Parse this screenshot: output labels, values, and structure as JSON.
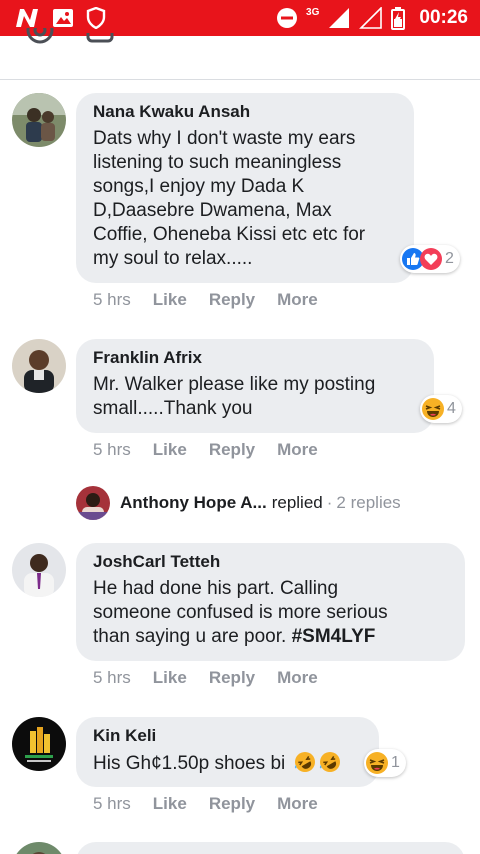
{
  "status_bar": {
    "time": "00:26",
    "network": "3G",
    "icons": [
      "n-app-icon",
      "gallery-icon",
      "shield-icon",
      "do-not-disturb-icon",
      "signal-icon",
      "battery-icon"
    ]
  },
  "comments": [
    {
      "author": "Nana Kwaku Ansah",
      "lines": [
        "Dats why I don't waste my ears",
        "listening to such meaningless",
        "songs,I enjoy my Dada K",
        "D,Daasebre Dwamena, Max",
        "Coffie, Oheneba Kissi etc etc for",
        "my soul to relax....."
      ],
      "reaction_count": "2",
      "reactions": [
        "like-icon",
        "love-icon"
      ],
      "time": "5 hrs",
      "like": "Like",
      "reply": "Reply",
      "more": "More"
    },
    {
      "author": "Franklin Afrix",
      "lines": [
        "Mr. Walker please like my posting",
        "small.....Thank you"
      ],
      "reaction_count": "4",
      "reactions": [
        "haha-icon"
      ],
      "time": "5 hrs",
      "like": "Like",
      "reply": "Reply",
      "more": "More",
      "replies": {
        "name": "Anthony Hope A...",
        "verb": "replied",
        "separator": "·",
        "count": "2 replies"
      }
    },
    {
      "author": "JoshCarl Tetteh",
      "lines": [
        "He had done his part. Calling",
        "someone confused is more serious",
        "than saying u are poor."
      ],
      "hashtag": "#SM4LYF",
      "time": "5 hrs",
      "like": "Like",
      "reply": "Reply",
      "more": "More"
    },
    {
      "author": "Kin Keli",
      "lines": [
        "His Gh¢1.50p shoes bi"
      ],
      "reaction_count": "1",
      "reactions": [
        "haha-icon"
      ],
      "time": "5 hrs",
      "like": "Like",
      "reply": "Reply",
      "more": "More"
    }
  ],
  "colors": {
    "status_bar": "#e8141b",
    "bubble": "#ebedf0",
    "meta_text": "#90949c",
    "like_blue": "#1877f2",
    "love_red": "#f33e58",
    "haha_yellow": "#f7b125"
  }
}
